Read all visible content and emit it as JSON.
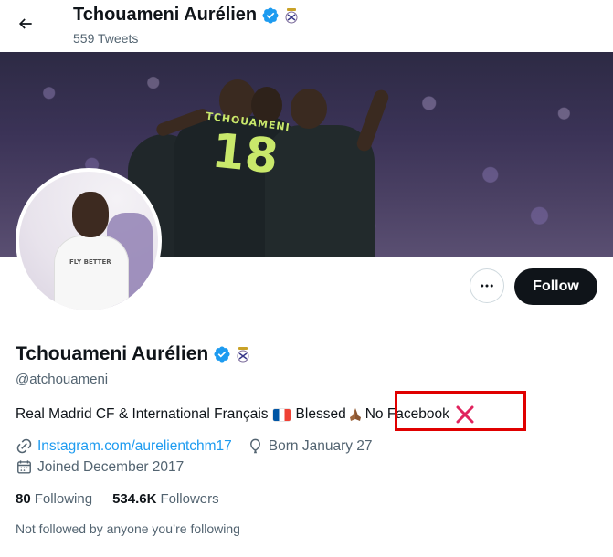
{
  "header": {
    "name": "Tchouameni Aurélien",
    "tweet_count": "559 Tweets"
  },
  "banner": {
    "jersey_name": "TCHOUAMENI",
    "jersey_number": "18"
  },
  "avatar": {
    "jersey_text": "FLY BETTER"
  },
  "actions": {
    "follow_label": "Follow"
  },
  "profile": {
    "name": "Tchouameni Aurélien",
    "handle": "@atchouameni",
    "bio_part1": "Real Madrid CF & International Français",
    "bio_part2": "Blessed",
    "bio_part3": "No Facebook",
    "link_text": "Instagram.com/aurelientchm17",
    "birthday": "Born January 27",
    "joined": "Joined December 2017"
  },
  "stats": {
    "following_count": "80",
    "following_label": "Following",
    "followers_count": "534.6K",
    "followers_label": "Followers"
  },
  "footer_note": "Not followed by anyone you’re following",
  "colors": {
    "accent": "#1d9bf0",
    "highlight": "#e00000",
    "text_primary": "#0f1419",
    "text_secondary": "#536471"
  }
}
